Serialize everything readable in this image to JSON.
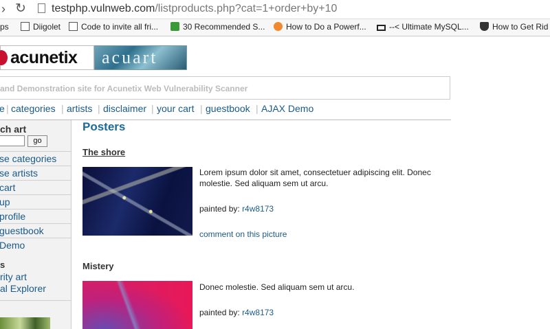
{
  "browser": {
    "url_host": "testphp.vulnweb.com",
    "url_path": "/listproducts.php?cat=1+order+by+10",
    "bookmarks": [
      {
        "label": "ps",
        "icon": "apps-icon"
      },
      {
        "label": "Diigolet",
        "icon": "page-icon"
      },
      {
        "label": "Code to invite all fri...",
        "icon": "page-icon"
      },
      {
        "label": "30 Recommended S...",
        "icon": "link-icon"
      },
      {
        "label": "How to Do a Powerf...",
        "icon": "circle-icon"
      },
      {
        "label": "--< Ultimate MySQL...",
        "icon": "computer-icon"
      },
      {
        "label": "How to Get Rid",
        "icon": "shield-icon"
      }
    ]
  },
  "site": {
    "logo_left": "acunetix",
    "logo_right": "acuart",
    "tagline": "and Demonstration site for Acunetix Web Vulnerability Scanner",
    "nav": [
      "e",
      "categories",
      "artists",
      "disclaimer",
      "your cart",
      "guestbook",
      "AJAX Demo"
    ]
  },
  "sidebar": {
    "search_title": "ch art",
    "go_label": "go",
    "links": [
      "se categories",
      "se artists",
      "cart",
      "up",
      "profile",
      "guestbook",
      "Demo"
    ],
    "links_title": "s",
    "external": [
      "rity art",
      "al Explorer"
    ]
  },
  "main": {
    "title": "Posters",
    "products": [
      {
        "title": "The shore",
        "desc": "Lorem ipsum dolor sit amet, consectetuer adipiscing elit. Donec molestie. Sed aliquam sem ut arcu.",
        "painted_label": "painted by:",
        "artist": "r4w8173",
        "comment": "comment on this picture"
      },
      {
        "title": "Mistery",
        "desc": "Donec molestie. Sed aliquam sem ut arcu.",
        "painted_label": "painted by:",
        "artist": "r4w8173"
      }
    ]
  }
}
